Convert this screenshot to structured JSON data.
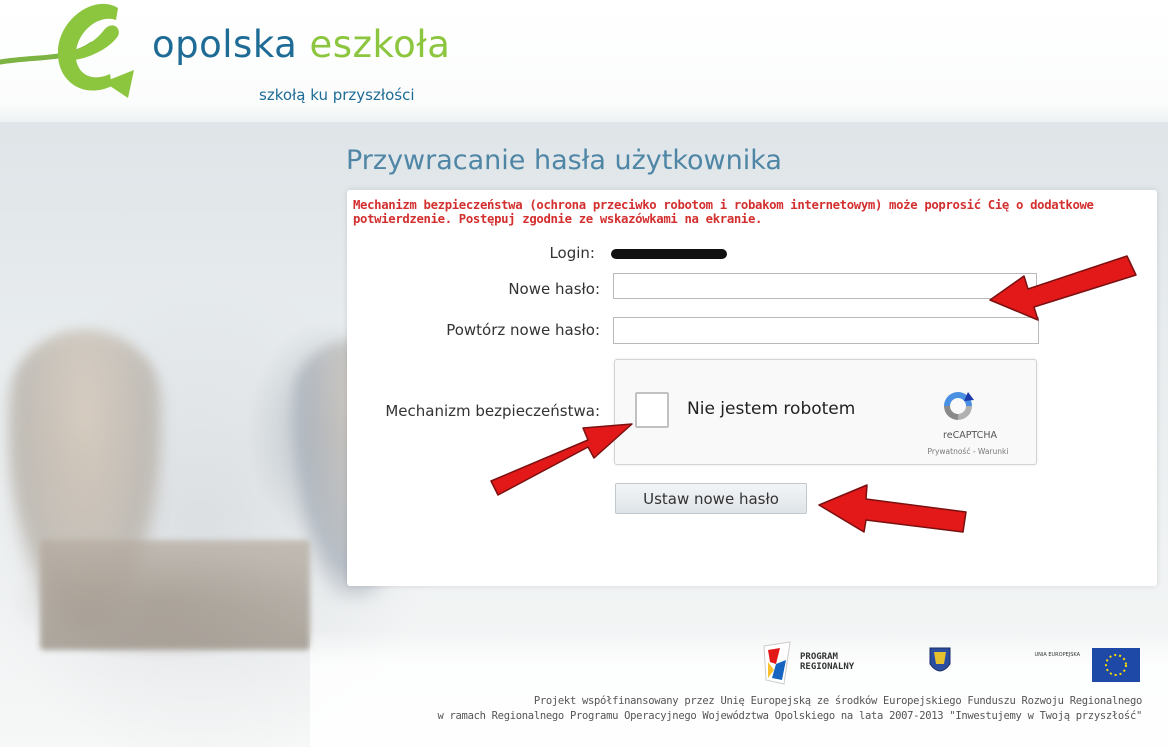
{
  "header": {
    "brand_name_part1": "opolska ",
    "brand_name_part2": "eszkoła",
    "tagline": "szkołą ku przyszłości"
  },
  "page": {
    "title": "Przywracanie hasła użytkownika",
    "security_notice": "Mechanizm bezpieczeństwa (ochrona przeciwko robotom i robakom internetowym) może poprosić Cię o dodatkowe potwierdzenie. Postępuj zgodnie ze wskazówkami na ekranie."
  },
  "form": {
    "login_label": "Login:",
    "login_value_redacted": true,
    "new_password_label": "Nowe hasło:",
    "new_password_value": "",
    "repeat_password_label": "Powtórz nowe hasło:",
    "repeat_password_value": "",
    "security_label": "Mechanizm bezpieczeństwa:",
    "submit_label": "Ustaw nowe hasło"
  },
  "recaptcha": {
    "checkbox_label": "Nie jestem robotem",
    "brand": "reCAPTCHA",
    "links": "Prywatność - Warunki",
    "checked": false
  },
  "footer": {
    "program_logo_line1": "PROGRAM",
    "program_logo_line2": "REGIONALNY",
    "eu_logo_text": "UNIA EUROPEJSKA",
    "line1": "Projekt współfinansowany przez Unię Europejską ze środków Europejskiego Funduszu Rozwoju Regionalnego",
    "line2": "w ramach Regionalnego Programu Operacyjnego Województwa Opolskiego na lata 2007-2013 \"Inwestujemy w Twoją przyszłość\""
  },
  "colors": {
    "brand_blue": "#1e6c96",
    "brand_green": "#8cc63f",
    "notice_red": "#d32f2f",
    "arrow_red": "#e31919"
  }
}
